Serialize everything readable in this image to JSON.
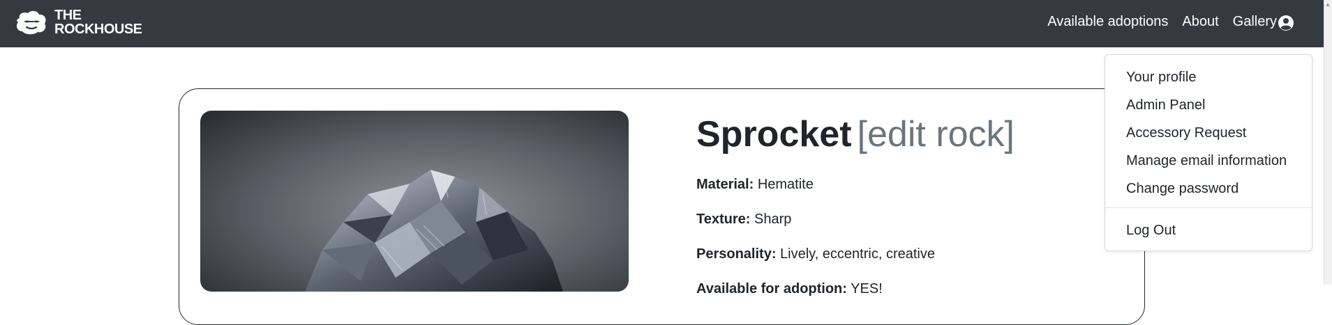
{
  "navbar": {
    "brand_line1": "THE",
    "brand_line2": "ROCKHOUSE",
    "links": [
      "Available adoptions",
      "About",
      "Gallery"
    ],
    "user_icon": "user-circle-icon",
    "background": "#343a40"
  },
  "rock": {
    "name": "Sprocket",
    "edit_label": "[edit rock]",
    "attributes": [
      {
        "label": "Material:",
        "value": "Hematite"
      },
      {
        "label": "Texture:",
        "value": "Sharp"
      },
      {
        "label": "Personality:",
        "value": "Lively, eccentric, creative"
      },
      {
        "label": "Available for adoption:",
        "value": "YES!"
      }
    ]
  },
  "dropdown": {
    "items": [
      "Your profile",
      "Admin Panel",
      "Accessory Request",
      "Manage email information",
      "Change password"
    ],
    "logout": "Log Out"
  },
  "colors": {
    "edit_link": "#6c757d",
    "text": "#212529"
  }
}
